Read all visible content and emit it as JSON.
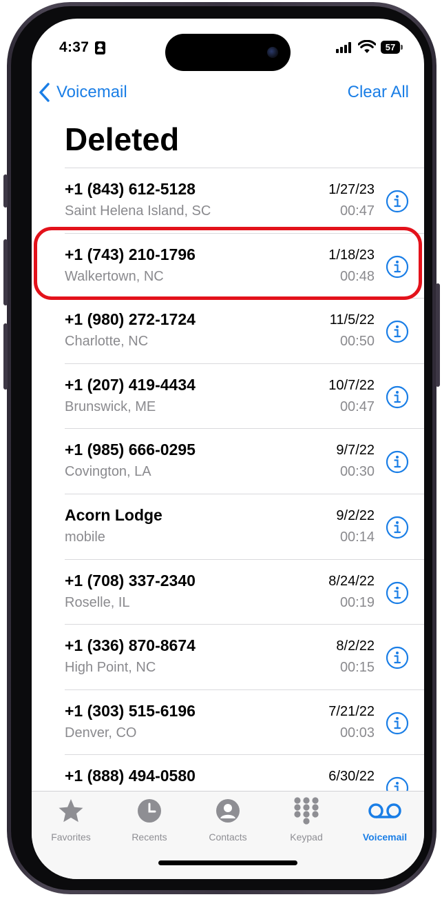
{
  "status": {
    "time": "4:37",
    "battery": "57"
  },
  "nav": {
    "back_label": "Voicemail",
    "action_label": "Clear All"
  },
  "title": "Deleted",
  "voicemails": [
    {
      "name": "+1 (843) 612-5128",
      "location": "Saint Helena Island, SC",
      "date": "1/27/23",
      "duration": "00:47"
    },
    {
      "name": "+1 (743) 210-1796",
      "location": "Walkertown, NC",
      "date": "1/18/23",
      "duration": "00:48",
      "highlighted": true
    },
    {
      "name": "+1 (980) 272-1724",
      "location": "Charlotte, NC",
      "date": "11/5/22",
      "duration": "00:50"
    },
    {
      "name": "+1 (207) 419-4434",
      "location": "Brunswick, ME",
      "date": "10/7/22",
      "duration": "00:47"
    },
    {
      "name": "+1 (985) 666-0295",
      "location": "Covington, LA",
      "date": "9/7/22",
      "duration": "00:30"
    },
    {
      "name": "Acorn Lodge",
      "location": "mobile",
      "date": "9/2/22",
      "duration": "00:14"
    },
    {
      "name": "+1 (708) 337-2340",
      "location": "Roselle, IL",
      "date": "8/24/22",
      "duration": "00:19"
    },
    {
      "name": "+1 (336) 870-8674",
      "location": "High Point, NC",
      "date": "8/2/22",
      "duration": "00:15"
    },
    {
      "name": "+1 (303) 515-6196",
      "location": "Denver, CO",
      "date": "7/21/22",
      "duration": "00:03"
    },
    {
      "name": "+1 (888) 494-0580",
      "location": "",
      "date": "6/30/22",
      "duration": ""
    }
  ],
  "tabs": [
    {
      "label": "Favorites",
      "icon": "star-icon"
    },
    {
      "label": "Recents",
      "icon": "clock-icon"
    },
    {
      "label": "Contacts",
      "icon": "person-icon"
    },
    {
      "label": "Keypad",
      "icon": "keypad-icon"
    },
    {
      "label": "Voicemail",
      "icon": "voicemail-icon",
      "active": true
    }
  ],
  "colors": {
    "accent": "#1a7ee6",
    "highlight": "#e3121b",
    "secondary_text": "#8a8a8e"
  }
}
